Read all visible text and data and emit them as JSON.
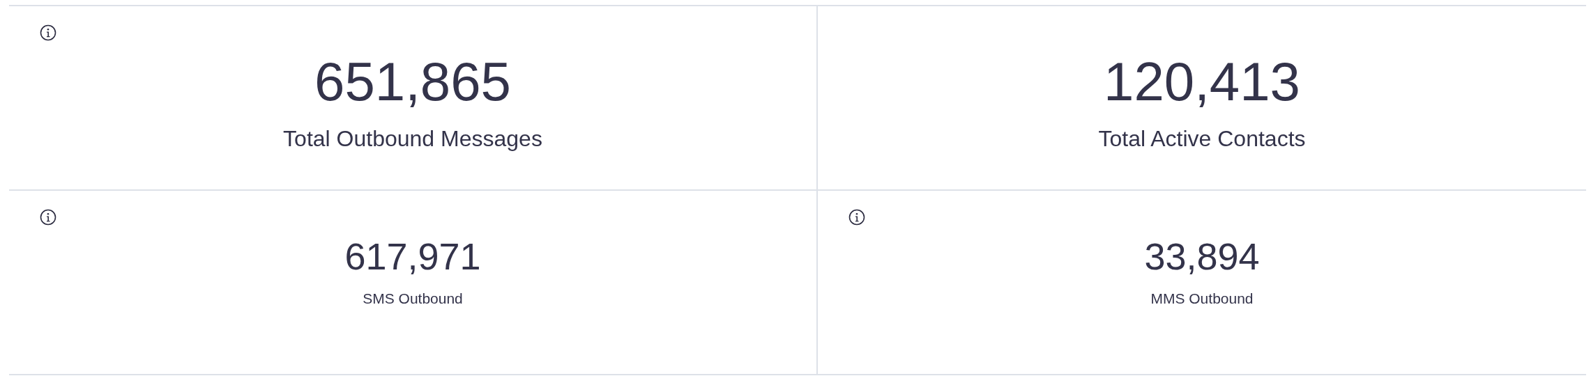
{
  "metrics": [
    {
      "value": "651,865",
      "label": "Total Outbound Messages",
      "kind": "large",
      "info": true
    },
    {
      "value": "120,413",
      "label": "Total Active Contacts",
      "kind": "large",
      "info": false
    },
    {
      "value": "617,971",
      "label": "SMS Outbound",
      "kind": "small",
      "info": true
    },
    {
      "value": "33,894",
      "label": "MMS Outbound",
      "kind": "small",
      "info": true
    }
  ]
}
